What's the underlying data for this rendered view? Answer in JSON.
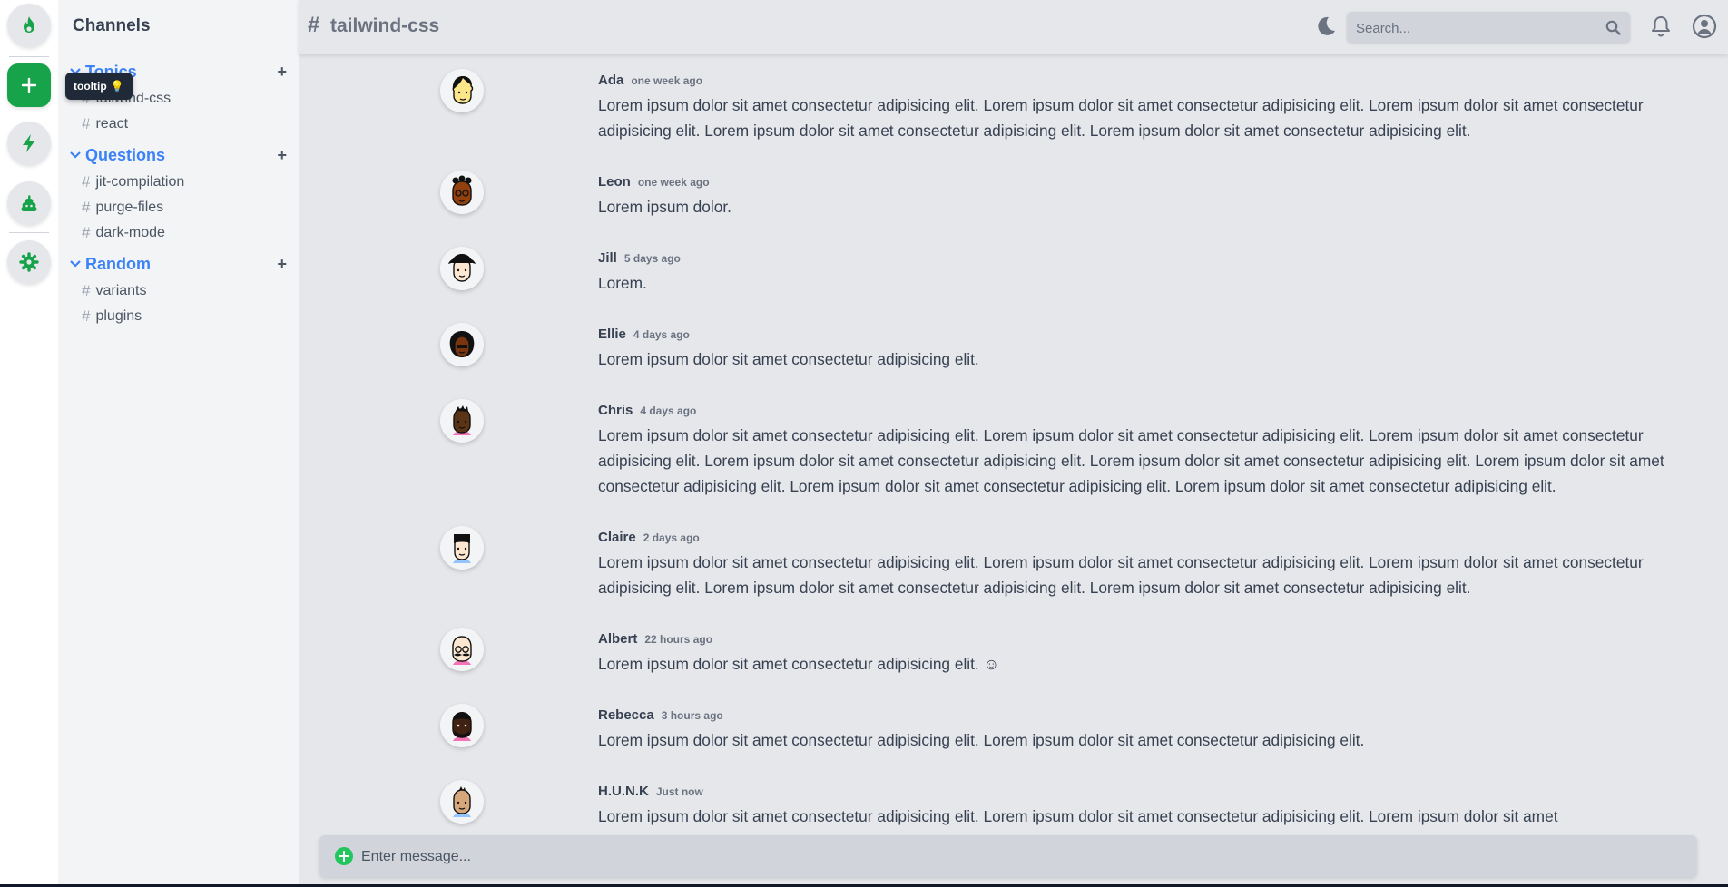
{
  "rail": {
    "tooltip_text": "tooltip",
    "tooltip_emoji": "💡",
    "icons": [
      "fire-icon",
      "plus-icon",
      "bolt-icon",
      "poop-icon",
      "gear-icon"
    ],
    "accent_color": "#16a34a"
  },
  "sidebar": {
    "title": "Channels",
    "groups": [
      {
        "name": "Topics",
        "channels": [
          "tailwind-css",
          "react"
        ]
      },
      {
        "name": "Questions",
        "channels": [
          "jit-compilation",
          "purge-files",
          "dark-mode"
        ]
      },
      {
        "name": "Random",
        "channels": [
          "variants",
          "plugins"
        ]
      }
    ],
    "hash": "#",
    "add": "+"
  },
  "header": {
    "hash": "#",
    "title": "tailwind-css",
    "search_placeholder": "Search..."
  },
  "messages": [
    {
      "name": "Ada",
      "time": "one week ago",
      "text": "Lorem ipsum dolor sit amet consectetur adipisicing elit. Lorem ipsum dolor sit amet consectetur adipisicing elit. Lorem ipsum dolor sit amet consectetur adipisicing elit. Lorem ipsum dolor sit amet consectetur adipisicing elit. Lorem ipsum dolor sit amet consectetur adipisicing elit."
    },
    {
      "name": "Leon",
      "time": "one week ago",
      "text": "Lorem ipsum dolor."
    },
    {
      "name": "Jill",
      "time": "5 days ago",
      "text": "Lorem."
    },
    {
      "name": "Ellie",
      "time": "4 days ago",
      "text": "Lorem ipsum dolor sit amet consectetur adipisicing elit."
    },
    {
      "name": "Chris",
      "time": "4 days ago",
      "text": "Lorem ipsum dolor sit amet consectetur adipisicing elit. Lorem ipsum dolor sit amet consectetur adipisicing elit. Lorem ipsum dolor sit amet consectetur adipisicing elit. Lorem ipsum dolor sit amet consectetur adipisicing elit. Lorem ipsum dolor sit amet consectetur adipisicing elit. Lorem ipsum dolor sit amet consectetur adipisicing elit. Lorem ipsum dolor sit amet consectetur adipisicing elit. Lorem ipsum dolor sit amet consectetur adipisicing elit."
    },
    {
      "name": "Claire",
      "time": "2 days ago",
      "text": "Lorem ipsum dolor sit amet consectetur adipisicing elit. Lorem ipsum dolor sit amet consectetur adipisicing elit. Lorem ipsum dolor sit amet consectetur adipisicing elit. Lorem ipsum dolor sit amet consectetur adipisicing elit. Lorem ipsum dolor sit amet consectetur adipisicing elit."
    },
    {
      "name": "Albert",
      "time": "22 hours ago",
      "text": "Lorem ipsum dolor sit amet consectetur adipisicing elit. ☺"
    },
    {
      "name": "Rebecca",
      "time": "3 hours ago",
      "text": "Lorem ipsum dolor sit amet consectetur adipisicing elit. Lorem ipsum dolor sit amet consectetur adipisicing elit."
    },
    {
      "name": "H.U.N.K",
      "time": "Just now",
      "text": "Lorem ipsum dolor sit amet consectetur adipisicing elit. Lorem ipsum dolor sit amet consectetur adipisicing elit. Lorem ipsum dolor sit amet"
    }
  ],
  "composer": {
    "placeholder": "Enter message..."
  }
}
